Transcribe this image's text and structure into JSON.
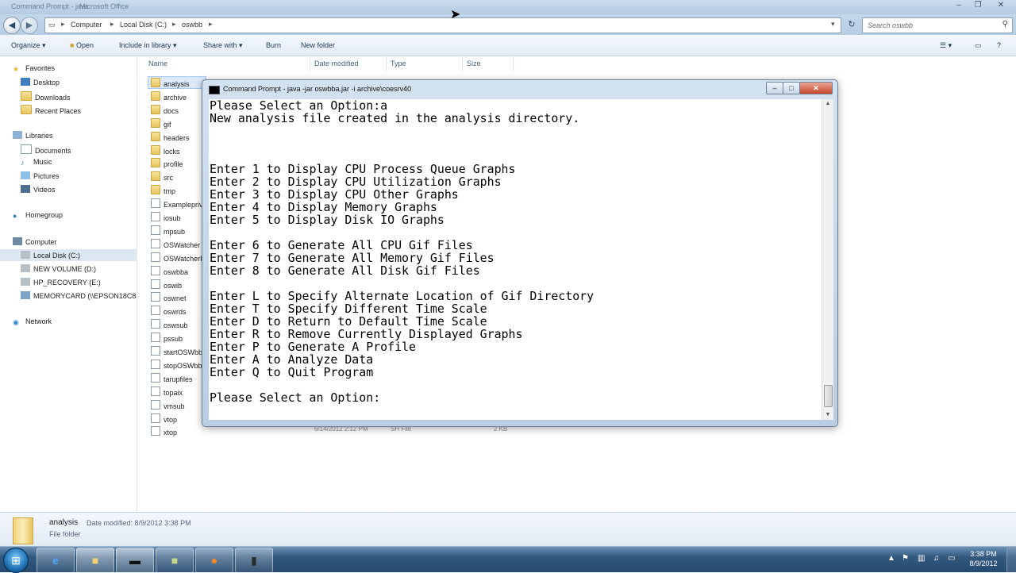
{
  "explorer": {
    "window_title": "Command Prompt - java",
    "window_title2": "Microsoft Office",
    "breadcrumbs": [
      "Computer",
      "Local Disk (C:)",
      "oswbb"
    ],
    "search_placeholder": "Search oswbb",
    "toolbar": {
      "organize": "Organize",
      "open": "Open",
      "include": "Include in library",
      "share": "Share with",
      "burn": "Burn",
      "new_folder": "New folder"
    },
    "columns": {
      "name": "Name",
      "date": "Date modified",
      "type": "Type",
      "size": "Size"
    },
    "nav": {
      "favorites": "Favorites",
      "desktop": "Desktop",
      "downloads": "Downloads",
      "recent": "Recent Places",
      "libraries": "Libraries",
      "documents": "Documents",
      "music": "Music",
      "pictures": "Pictures",
      "videos": "Videos",
      "homegroup": "Homegroup",
      "computer": "Computer",
      "local_disk": "Local Disk (C:)",
      "new_volume": "NEW VOLUME (D:)",
      "hp_recovery": "HP_RECOVERY (E:)",
      "memorycard": "MEMORYCARD (\\\\EPSON18C8",
      "network": "Network"
    },
    "files": [
      {
        "name": "analysis",
        "kind": "folder"
      },
      {
        "name": "archive",
        "kind": "folder"
      },
      {
        "name": "docs",
        "kind": "folder"
      },
      {
        "name": "gif",
        "kind": "folder"
      },
      {
        "name": "headers",
        "kind": "folder"
      },
      {
        "name": "locks",
        "kind": "folder"
      },
      {
        "name": "profile",
        "kind": "folder"
      },
      {
        "name": "src",
        "kind": "folder"
      },
      {
        "name": "tmp",
        "kind": "folder"
      },
      {
        "name": "Examplepriv",
        "kind": "file"
      },
      {
        "name": "iosub",
        "kind": "file"
      },
      {
        "name": "mpsub",
        "kind": "file"
      },
      {
        "name": "OSWatcher",
        "kind": "file"
      },
      {
        "name": "OSWatcherF",
        "kind": "file"
      },
      {
        "name": "oswbba",
        "kind": "file"
      },
      {
        "name": "oswib",
        "kind": "file"
      },
      {
        "name": "oswnet",
        "kind": "file"
      },
      {
        "name": "oswrds",
        "kind": "file"
      },
      {
        "name": "oswsub",
        "kind": "file"
      },
      {
        "name": "pssub",
        "kind": "file"
      },
      {
        "name": "startOSWbb",
        "kind": "file"
      },
      {
        "name": "stopOSWbb",
        "kind": "file"
      },
      {
        "name": "tarupfiles",
        "kind": "file"
      },
      {
        "name": "topaix",
        "kind": "file"
      },
      {
        "name": "vmsub",
        "kind": "file"
      },
      {
        "name": "vtop",
        "kind": "file"
      },
      {
        "name": "xtop",
        "kind": "file"
      }
    ],
    "last_row": {
      "date": "6/14/2012 2:12 PM",
      "type": "SH File",
      "size": "2 KB"
    },
    "details": {
      "name": "analysis",
      "modified": "Date modified: 8/9/2012 3:38 PM",
      "type": "File folder"
    }
  },
  "cmd": {
    "title": "Command Prompt - java  -jar oswbba.jar -i archive\\coesrv40",
    "lines": [
      "Please Select an Option:a",
      "New analysis file created in the analysis directory.",
      "",
      "",
      "",
      "Enter 1 to Display CPU Process Queue Graphs",
      "Enter 2 to Display CPU Utilization Graphs",
      "Enter 3 to Display CPU Other Graphs",
      "Enter 4 to Display Memory Graphs",
      "Enter 5 to Display Disk IO Graphs",
      "",
      "Enter 6 to Generate All CPU Gif Files",
      "Enter 7 to Generate All Memory Gif Files",
      "Enter 8 to Generate All Disk Gif Files",
      "",
      "Enter L to Specify Alternate Location of Gif Directory",
      "Enter T to Specify Different Time Scale",
      "Enter D to Return to Default Time Scale",
      "Enter R to Remove Currently Displayed Graphs",
      "Enter P to Generate A Profile",
      "Enter A to Analyze Data",
      "Enter Q to Quit Program",
      "",
      "Please Select an Option:"
    ]
  },
  "taskbar": {
    "time": "3:38 PM",
    "date": "8/9/2012"
  }
}
